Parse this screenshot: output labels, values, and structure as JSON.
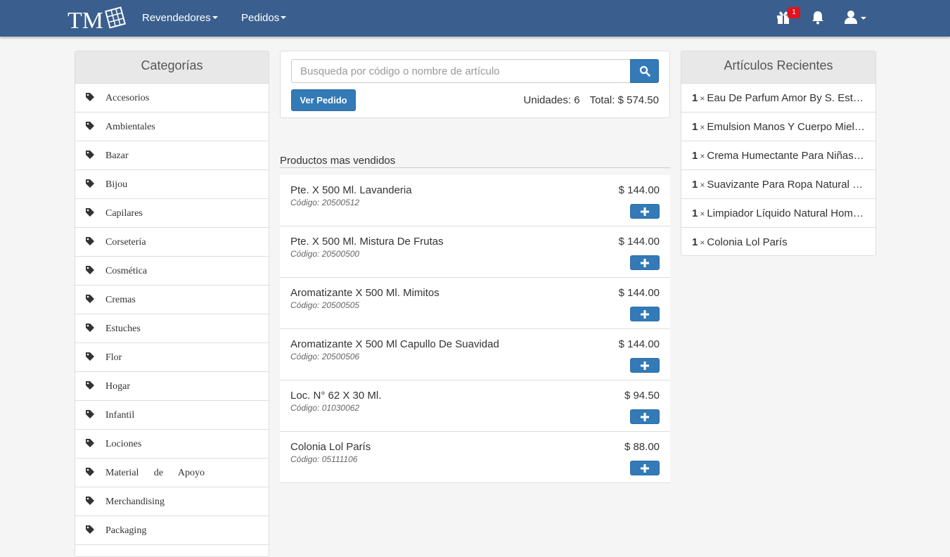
{
  "nav": {
    "logo_text": "TM",
    "menus": [
      "Revendedores",
      "Pedidos"
    ],
    "gift_badge": "1",
    "icons": [
      "gift-icon",
      "bell-icon",
      "user-icon"
    ]
  },
  "categories": {
    "title": "Categorías",
    "items": [
      "Accesorios",
      "Ambientales",
      "Bazar",
      "Bijou",
      "Capilares",
      "Corsetería",
      "Cosmética",
      "Cremas",
      "Estuches",
      "Flor",
      "Hogar",
      "Infantil",
      "Lociones",
      "Material de Apoyo",
      "Merchandising",
      "Packaging"
    ]
  },
  "search": {
    "placeholder": "Busqueda por código o nombre de artículo",
    "order_button": "Ver Pedido",
    "units": "Unidades: 6",
    "total": "Total: $ 574.50"
  },
  "products": {
    "title": "Productos mas vendidos",
    "items": [
      {
        "name": "Pte. X 500 Ml. Lavanderia",
        "code": "Código: 20500512",
        "price": "$ 144.00"
      },
      {
        "name": "Pte. X 500 Ml. Mistura De Frutas",
        "code": "Código: 20500500",
        "price": "$ 144.00"
      },
      {
        "name": "Aromatizante X 500 Ml. Mimitos",
        "code": "Código: 20500505",
        "price": "$ 144.00"
      },
      {
        "name": "Aromatizante X 500 Ml Capullo De Suavidad",
        "code": "Código: 20500506",
        "price": "$ 144.00"
      },
      {
        "name": "Loc. N° 62 X 30 Ml.",
        "code": "Código: 01030062",
        "price": "$ 94.50"
      },
      {
        "name": "Colonia Lol París",
        "code": "Código: 05111106",
        "price": "$ 88.00"
      }
    ]
  },
  "recent": {
    "title": "Artículos Recientes",
    "items": [
      {
        "qty": "1",
        "name": "Eau De Parfum Amor By S. Estefanía"
      },
      {
        "qty": "1",
        "name": "Emulsion Manos Y Cuerpo Miel Y Avena"
      },
      {
        "qty": "1",
        "name": "Crema Humectante Para Niñas Frutilla"
      },
      {
        "qty": "1",
        "name": "Suavizante Para Ropa Natural Home"
      },
      {
        "qty": "1",
        "name": "Limpiador Líquido Natural Home Pisos"
      },
      {
        "qty": "1",
        "name": "Colonia Lol París"
      }
    ]
  }
}
